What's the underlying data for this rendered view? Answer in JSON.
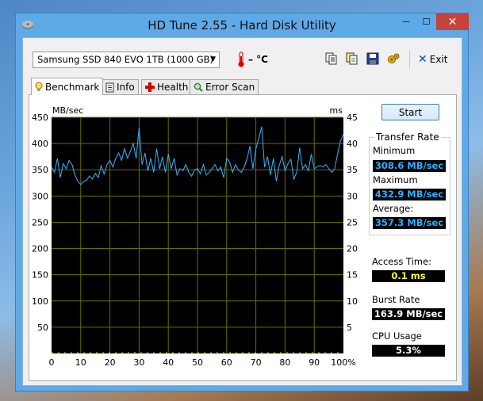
{
  "window": {
    "title": "HD Tune 2.55 - Hard Disk Utility",
    "close_glyph": "✕",
    "minimize_glyph": "—",
    "maximize_glyph": "☐"
  },
  "toolbar": {
    "drive": "Samsung SSD 840 EVO 1TB (1000 GB)",
    "temperature": "– °C",
    "exit_label": "Exit",
    "icons": [
      "copy-info-icon",
      "copy-text-icon",
      "save-icon",
      "options-icon",
      "exit-icon"
    ]
  },
  "tabs": [
    {
      "label": "Benchmark",
      "icon": "lightbulb-icon"
    },
    {
      "label": "Info",
      "icon": "document-icon"
    },
    {
      "label": "Health",
      "icon": "health-cross-icon"
    },
    {
      "label": "Error Scan",
      "icon": "magnifier-icon"
    }
  ],
  "colors": {
    "accent": "#3bb0ff",
    "chart_bg": "#000000",
    "grid": "#6b6b00",
    "value_cyan": "#2bb0ff",
    "value_yellow": "#ffff2a"
  },
  "controls": {
    "start_label": "Start"
  },
  "results": {
    "transfer_rate_title": "Transfer Rate",
    "minimum_label": "Minimum",
    "minimum_value": "308.6 MB/sec",
    "maximum_label": "Maximum",
    "maximum_value": "432.9 MB/sec",
    "average_label": "Average:",
    "average_value": "357.3 MB/sec",
    "access_time_label": "Access Time:",
    "access_time_value": "0.1 ms",
    "burst_rate_label": "Burst Rate",
    "burst_rate_value": "163.9 MB/sec",
    "cpu_usage_label": "CPU Usage",
    "cpu_usage_value": "5.3%"
  },
  "chart_data": {
    "type": "line",
    "title": "",
    "ylabel_left": "MB/sec",
    "ylabel_right": "ms",
    "left_ticks": [
      "450",
      "400",
      "350",
      "300",
      "250",
      "200",
      "150",
      "100",
      "50"
    ],
    "right_ticks": [
      "45",
      "40",
      "35",
      "30",
      "25",
      "20",
      "15",
      "10",
      "5"
    ],
    "x_ticks": [
      "0",
      "10",
      "20",
      "30",
      "40",
      "50",
      "60",
      "70",
      "80",
      "90",
      "100%"
    ],
    "xlim": [
      0,
      100
    ],
    "ylim_left": [
      0,
      450
    ],
    "ylim_right": [
      0,
      45
    ],
    "grid": true,
    "series": [
      {
        "x": [
          0,
          1,
          2,
          3,
          4,
          5,
          6,
          7,
          8,
          9,
          10,
          11,
          12,
          13,
          14,
          15,
          16,
          17,
          18,
          19,
          20,
          21,
          22,
          23,
          24,
          25,
          26,
          27,
          28,
          29,
          30,
          31,
          32,
          33,
          34,
          35,
          36,
          37,
          38,
          39,
          40,
          41,
          42,
          43,
          44,
          45,
          46,
          47,
          48,
          49,
          50,
          51,
          52,
          53,
          54,
          55,
          56,
          57,
          58,
          59,
          60,
          61,
          62,
          63,
          64,
          65,
          66,
          67,
          68,
          69,
          70,
          71,
          72,
          73,
          74,
          75,
          76,
          77,
          78,
          79,
          80,
          81,
          82,
          83,
          84,
          85,
          86,
          87,
          88,
          89,
          90,
          91,
          92,
          93,
          94,
          95,
          96,
          97,
          98,
          99,
          100
        ],
        "y": [
          355,
          345,
          372,
          335,
          362,
          352,
          368,
          360,
          340,
          328,
          322,
          328,
          330,
          338,
          332,
          343,
          335,
          358,
          342,
          360,
          368,
          355,
          372,
          382,
          368,
          390,
          372,
          385,
          400,
          372,
          430,
          360,
          382,
          348,
          372,
          345,
          390,
          352,
          375,
          345,
          380,
          352,
          372,
          340,
          352,
          348,
          360,
          345,
          338,
          350,
          352,
          342,
          360,
          340,
          345,
          352,
          360,
          348,
          355,
          335,
          372,
          365,
          345,
          360,
          350,
          345,
          355,
          372,
          395,
          352,
          390,
          410,
          432,
          355,
          375,
          340,
          372,
          328,
          358,
          375,
          348,
          362,
          370,
          332,
          345,
          392,
          352,
          360,
          348,
          380,
          352,
          356,
          358,
          355,
          360,
          352,
          345,
          352,
          380,
          405,
          418
        ]
      }
    ]
  }
}
